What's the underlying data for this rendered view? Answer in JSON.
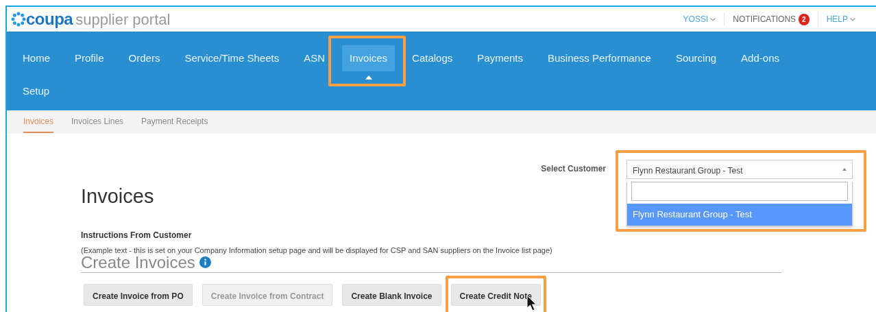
{
  "header": {
    "logo_brand": "coupa",
    "logo_product": "supplier portal",
    "user_menu": "YOSSI",
    "notifications": {
      "label": "NOTIFICATIONS",
      "count": "2"
    },
    "help_menu": "HELP"
  },
  "nav": [
    {
      "label": "Home",
      "selected": false,
      "highlighted": false
    },
    {
      "label": "Profile",
      "selected": false,
      "highlighted": false
    },
    {
      "label": "Orders",
      "selected": false,
      "highlighted": false
    },
    {
      "label": "Service/Time Sheets",
      "selected": false,
      "highlighted": false
    },
    {
      "label": "ASN",
      "selected": false,
      "highlighted": false
    },
    {
      "label": "Invoices",
      "selected": true,
      "highlighted": true
    },
    {
      "label": "Catalogs",
      "selected": false,
      "highlighted": false
    },
    {
      "label": "Payments",
      "selected": false,
      "highlighted": false
    },
    {
      "label": "Business Performance",
      "selected": false,
      "highlighted": false
    },
    {
      "label": "Sourcing",
      "selected": false,
      "highlighted": false
    },
    {
      "label": "Add-ons",
      "selected": false,
      "highlighted": false
    },
    {
      "label": "Setup",
      "selected": false,
      "highlighted": false
    }
  ],
  "subnav": [
    {
      "label": "Invoices",
      "selected": true
    },
    {
      "label": "Invoices Lines",
      "selected": false
    },
    {
      "label": "Payment Receipts",
      "selected": false
    }
  ],
  "customer_select": {
    "label": "Select Customer",
    "value": "Flynn Restaurant Group - Test",
    "expanded": true,
    "highlighted": true,
    "options": [
      {
        "label": "Flynn Restaurant Group - Test",
        "selected": true
      }
    ]
  },
  "page_title": "Invoices",
  "instructions": {
    "title": "Instructions From Customer",
    "text": "(Example text - this is set on your Company Information setup page and will be displayed for CSP and SAN suppliers on the Invoice list page)"
  },
  "create_section": {
    "title": "Create Invoices",
    "buttons": [
      {
        "label": "Create Invoice from PO",
        "disabled": false,
        "highlighted": false
      },
      {
        "label": "Create Invoice from Contract",
        "disabled": true,
        "highlighted": false
      },
      {
        "label": "Create Blank Invoice",
        "disabled": false,
        "highlighted": false
      },
      {
        "label": "Create Credit Note",
        "disabled": false,
        "highlighted": true
      }
    ]
  }
}
